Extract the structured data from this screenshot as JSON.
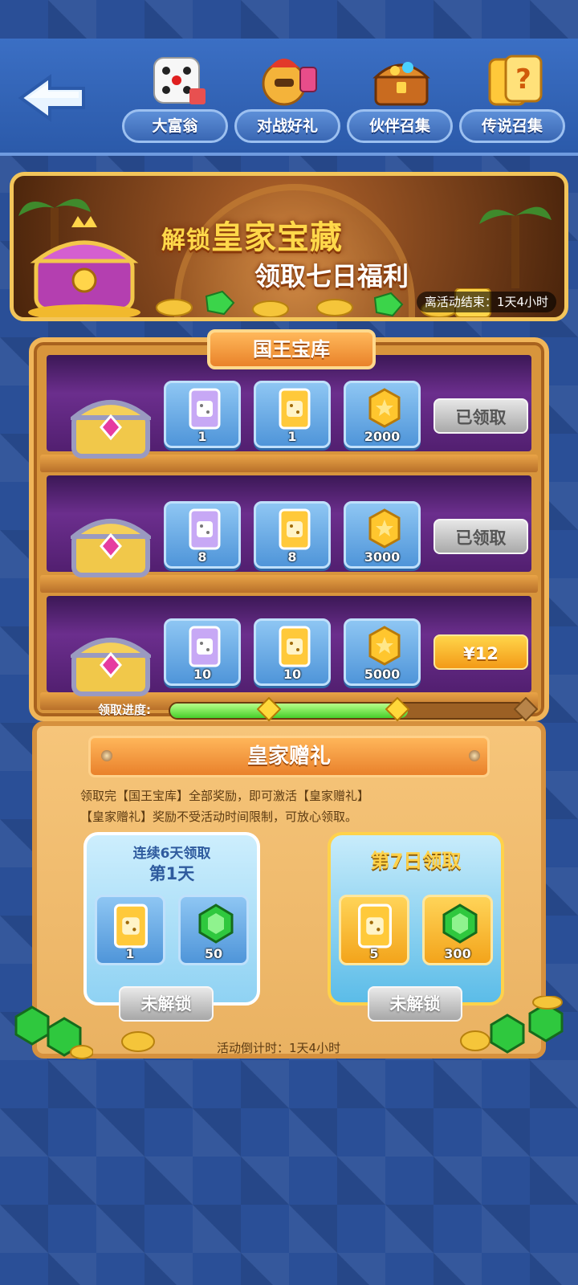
{
  "nav": {
    "items": [
      {
        "label": "大富翁",
        "icon": "dice-icon"
      },
      {
        "label": "对战好礼",
        "icon": "warrior-icon"
      },
      {
        "label": "伙伴召集",
        "icon": "treasure-chest-icon"
      },
      {
        "label": "传说召集",
        "icon": "mystery-card-icon"
      }
    ]
  },
  "banner": {
    "title_prefix": "解锁",
    "title_main": "皇家宝藏",
    "subtitle": "领取七日福利",
    "timer": "离活动结束：1天4小时"
  },
  "vault": {
    "title": "国王宝库",
    "rows": [
      {
        "rewards": [
          "1",
          "1",
          "2000"
        ],
        "status": "已领取"
      },
      {
        "rewards": [
          "8",
          "8",
          "3000"
        ],
        "status": "已领取"
      },
      {
        "rewards": [
          "10",
          "10",
          "5000"
        ],
        "status": "¥12"
      }
    ],
    "progress_label": "领取进度:",
    "progress_fraction": 0.67
  },
  "royal_gift": {
    "title": "皇家赠礼",
    "desc_line1": "领取完【国王宝库】全部奖励，即可激活【皇家赠礼】",
    "desc_line2": "【皇家赠礼】奖励不受活动时间限制，可放心领取。",
    "daily_card": {
      "head1": "连续6天领取",
      "head2": "第1天",
      "rewards": [
        "1",
        "50"
      ],
      "button": "未解锁"
    },
    "final_card": {
      "head": "第7日领取",
      "rewards": [
        "5",
        "300"
      ],
      "button": "未解锁"
    },
    "countdown": "活动倒计时：1天4小时"
  },
  "colors": {
    "background": "#2a4f97",
    "wood": "#d8953c",
    "buy_button": "#f39a17",
    "progress_green": "#47cf2b"
  }
}
